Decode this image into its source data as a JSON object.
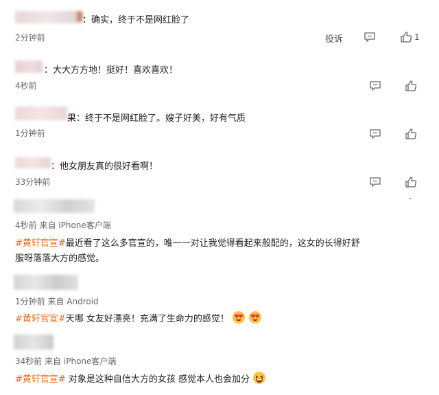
{
  "replies": [
    {
      "text": "：确实，终于不是网红脸了",
      "time": "2分钟前",
      "report": "投诉",
      "likes": "1"
    },
    {
      "text": "：大大方方地！挺好！喜欢喜欢！",
      "time": "4秒前"
    },
    {
      "text": "果：终于不是网红脸了。嫂子好美，好有气质",
      "time": "1分钟前"
    },
    {
      "text": "：他女朋友真的很好看啊！",
      "time": "33分钟前"
    }
  ],
  "comments": [
    {
      "meta": "4秒前  来自 iPhone客户端",
      "tag": "#黄轩官宣#",
      "line1": "最近看了这么多官宣的，唯一一对让我觉得看起来般配的，这女的长得好舒",
      "line2": "服呀落落大方的感觉。"
    },
    {
      "meta": "1分钟前  来自 Android",
      "tag": "#黄轩官宣#",
      "line1": "天哪 女友好漂亮！充满了生命力的感觉！"
    },
    {
      "meta": "34秒前  来自 iPhone客户端",
      "tag": "#黄轩官宣#",
      "line1": " 对象是这种自信大方的女孩 感觉本人也会加分"
    }
  ],
  "icons": [
    "comment-icon",
    "like-icon",
    "heart-eyes-emoji",
    "grinning-emoji"
  ],
  "colors": {
    "topic": "#f26d1f",
    "meta": "#666666",
    "icon": "#666666",
    "divider": "#eeeeee"
  }
}
